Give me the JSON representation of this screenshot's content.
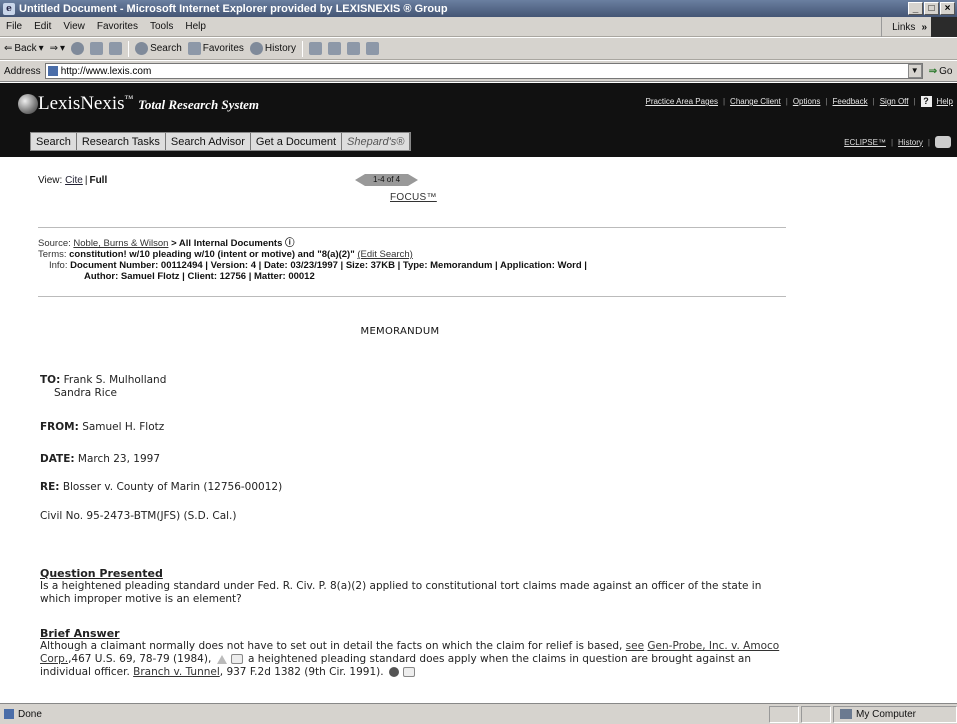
{
  "window": {
    "title": "Untitled Document - Microsoft Internet Explorer provided by LEXISNEXIS ® Group",
    "controls": [
      "_",
      "□",
      "×"
    ]
  },
  "menubar": {
    "items": [
      "File",
      "Edit",
      "View",
      "Favorites",
      "Tools",
      "Help"
    ],
    "links_label": "Links",
    "links_chevron": "»"
  },
  "toolbar": {
    "back_label": "Back",
    "search_label": "Search",
    "favorites_label": "Favorites",
    "history_label": "History"
  },
  "addressbar": {
    "label": "Address",
    "url": "http://www.lexis.com",
    "go_label": "Go"
  },
  "lexis": {
    "brand": "LexisNexis",
    "tm": "™",
    "subtitle": "Total Research System",
    "top_links": [
      "Practice Area Pages",
      "Change Client",
      "Options",
      "Feedback",
      "Sign Off",
      "Help"
    ],
    "tabs": [
      "Search",
      "Research Tasks",
      "Search Advisor",
      "Get a Document",
      "Shepard's®"
    ],
    "right_links": [
      "ECLIPSE™",
      "History"
    ]
  },
  "document": {
    "view_label": "View:",
    "view_cite": "Cite",
    "view_full": "Full",
    "pager": "1-4 of 4",
    "focus": "FOCUS™",
    "source_label": "Source:",
    "source_link": "Noble, Burns & Wilson",
    "source_rest": " > All Internal Documents ⓘ",
    "terms_label": "Terms:",
    "terms_text": "constitution! w/10 pleading w/10 (intent or motive) and \"8(a)(2)\"",
    "terms_edit": "(Edit Search)",
    "info_label": "Info:",
    "info_line1": "Document Number: 00112494  |  Version: 4  |  Date: 03/23/1997  |  Size: 37KB  |  Type: Memorandum  |  Application: Word  |",
    "info_line2": "Author: Samuel Flotz  |  Client: 12756  |  Matter: 00012",
    "memo_heading": "MEMORANDUM",
    "to_label": "TO:",
    "to_name1": "Frank S. Mulholland",
    "to_name2": "Sandra Rice",
    "from_label": "FROM:",
    "from_name": "Samuel H. Flotz",
    "date_label": "DATE:",
    "date_value": "March 23, 1997",
    "re_label": "RE:",
    "re_value": "Blosser v. County of Marin (12756-00012)",
    "civil_no": "Civil No. 95-2473-BTM(JFS) (S.D. Cal.)",
    "qp_title": "Question Presented",
    "qp_text": "Is a heightened pleading standard under Fed. R. Civ. P. 8(a)(2) applied to constitutional tort claims made against an officer of the state in which improper motive is an element?",
    "ba_title": "Brief Answer",
    "ba_text1": "Although a claimant normally does not have to set out in detail the facts on which the claim for relief is based, ",
    "ba_see": "see",
    "ba_case1": "Gen-Probe, Inc. v. Amoco Corp.",
    "ba_cite1": ",467 U.S. 69, 78-79 (1984),",
    "ba_text2": " a heightened pleading standard does apply when the claims in question are brought against an individual officer. ",
    "ba_case2": "Branch v. Tunnel",
    "ba_cite2": ", 937 F.2d 1382 (9th Cir. 1991)."
  },
  "statusbar": {
    "status": "Done",
    "zone": "My Computer"
  }
}
